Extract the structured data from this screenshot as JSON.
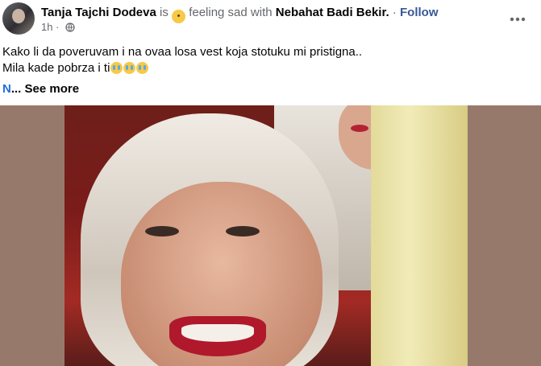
{
  "post": {
    "author": "Tanja Tajchi Dodeva",
    "is_text": "is",
    "feeling_text": "feeling sad with",
    "tagged": "Nebahat Badi Bekir.",
    "separator": "·",
    "follow": "Follow",
    "time": "1h",
    "line1": "Kako li da poveruvam i na ovaa losa vest koja stotuku mi pristigna..",
    "line2": "Mila kade pobrza i ti",
    "see_more_n": "N",
    "see_more": "... See more"
  },
  "icons": {
    "feeling": "sad-face-icon",
    "privacy": "globe-icon",
    "more": "more-horizontal-icon",
    "crying": "crying-face-icon"
  }
}
